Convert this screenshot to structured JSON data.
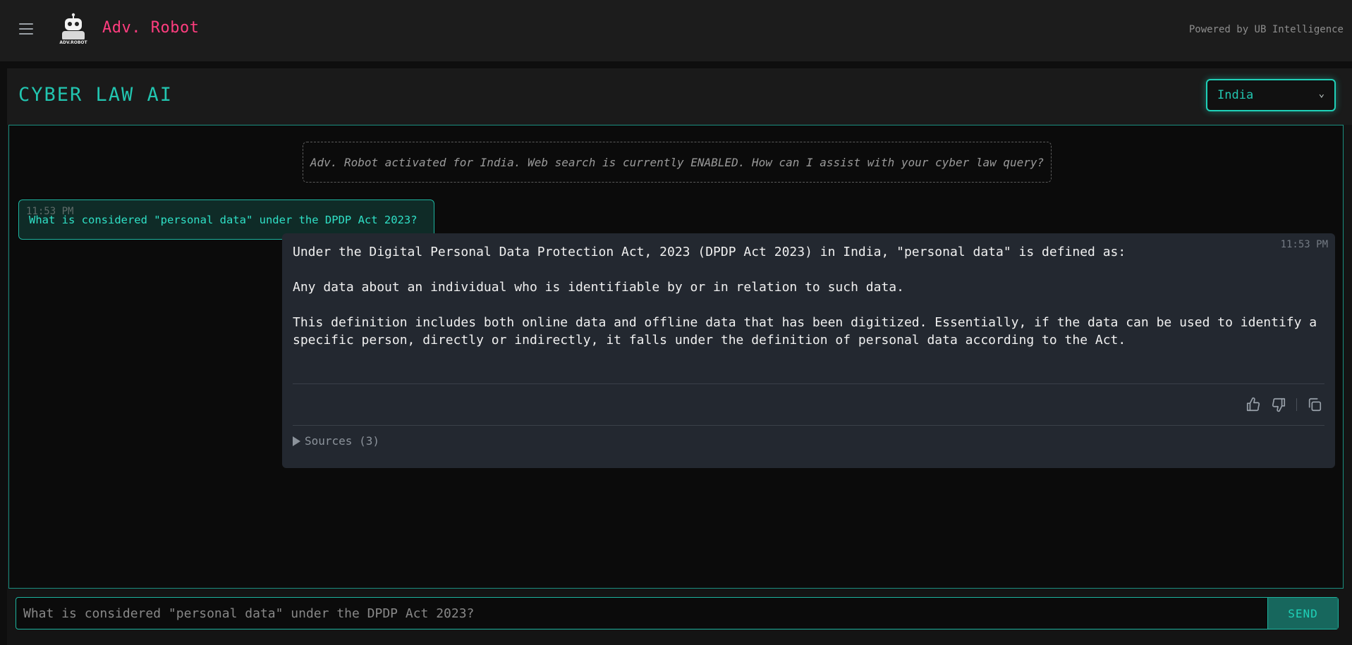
{
  "app": {
    "brand": "Adv. Robot",
    "powered_by": "Powered by UB Intelligence"
  },
  "header": {
    "title": "CYBER LAW AI",
    "country_selected": "India"
  },
  "chat": {
    "system_message": "Adv. Robot activated for India. Web search is currently ENABLED. How can I assist with your cyber law query?",
    "user_message": {
      "time": "11:53 PM",
      "text": "What is considered \"personal data\" under the DPDP Act 2023?"
    },
    "bot_message": {
      "time": "11:53 PM",
      "paragraphs": [
        "Under the Digital Personal Data Protection Act, 2023 (DPDP Act 2023) in India, \"personal data\" is defined as:",
        "Any data about an individual who is identifiable by or in relation to such data.",
        "This definition includes both online data and offline data that has been digitized. Essentially, if the data can be used to identify a specific person, directly or indirectly, it falls under the definition of personal data according to the Act."
      ],
      "sources_label": "Sources (3)"
    }
  },
  "input": {
    "placeholder": "What is considered \"personal data\" under the DPDP Act 2023?",
    "send_label": "SEND"
  },
  "colors": {
    "accent": "#1fd1b8",
    "brand": "#ff3d7f"
  }
}
